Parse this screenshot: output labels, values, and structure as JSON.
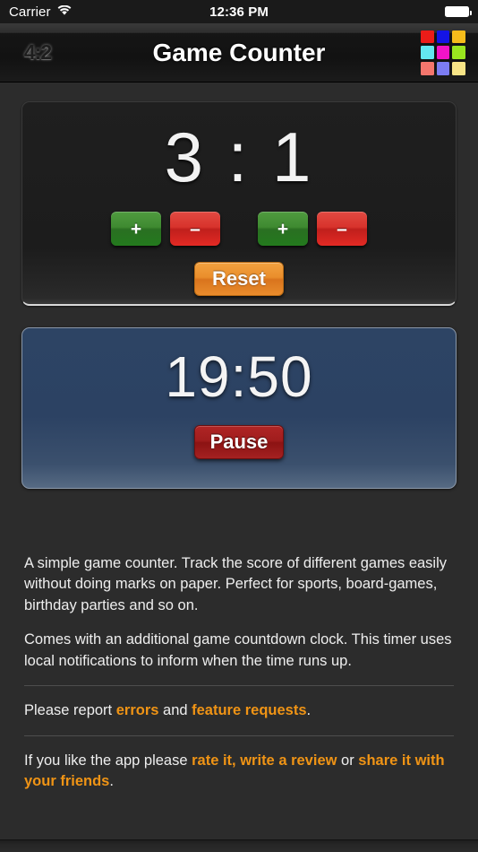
{
  "status_bar": {
    "carrier": "Carrier",
    "wifi_icon": "wifi-icon",
    "time": "12:36 PM",
    "battery_icon": "battery-full-icon"
  },
  "nav_bar": {
    "left_icon_label": "4:2",
    "left_icon_name": "app-logo-icon",
    "title": "Game Counter",
    "right_icon_name": "color-grid-icon",
    "right_icon_colors": [
      "#ec1c18",
      "#1414e6",
      "#f5bc1b",
      "#63e8f0",
      "#f213c8",
      "#9ae61f",
      "#f4766d",
      "#7b7cf2",
      "#f7e486"
    ]
  },
  "score_panel": {
    "score_display": "3 : 1",
    "home_score": 3,
    "away_score": 1,
    "separator": ":",
    "buttons": [
      {
        "name": "home-increment-button",
        "label": "+",
        "color": "green"
      },
      {
        "name": "home-decrement-button",
        "label": "–",
        "color": "red"
      },
      {
        "name": "away-increment-button",
        "label": "+",
        "color": "green"
      },
      {
        "name": "away-decrement-button",
        "label": "–",
        "color": "red"
      }
    ],
    "reset_label": "Reset"
  },
  "timer_panel": {
    "time_remaining": "19:50",
    "minutes": 19,
    "seconds": 50,
    "action_label": "Pause"
  },
  "description": {
    "paragraph_1": "A simple game counter. Track the score of different games easily without doing marks on paper. Perfect for sports, board-games, birthday parties and so on.",
    "paragraph_2": "Comes with an additional game countdown clock. This timer uses local notifications to inform when the time runs up.",
    "report_prefix": "Please report ",
    "link_errors": "errors",
    "report_middle": " and ",
    "link_feature_requests": "feature requests",
    "report_suffix": ".",
    "like_prefix": "If you like the app please ",
    "link_rate_review": "rate it, write a review",
    "like_middle": " or ",
    "link_share": "share it with your friends",
    "like_suffix": "."
  },
  "colors": {
    "background": "#2c2c2c",
    "accent_link": "#f09415",
    "timer_panel": "#2c4263",
    "reset_button": "#e98c2c",
    "pause_button": "#a01d1d",
    "increment_button": "#3f8a31",
    "decrement_button": "#d8332c"
  }
}
